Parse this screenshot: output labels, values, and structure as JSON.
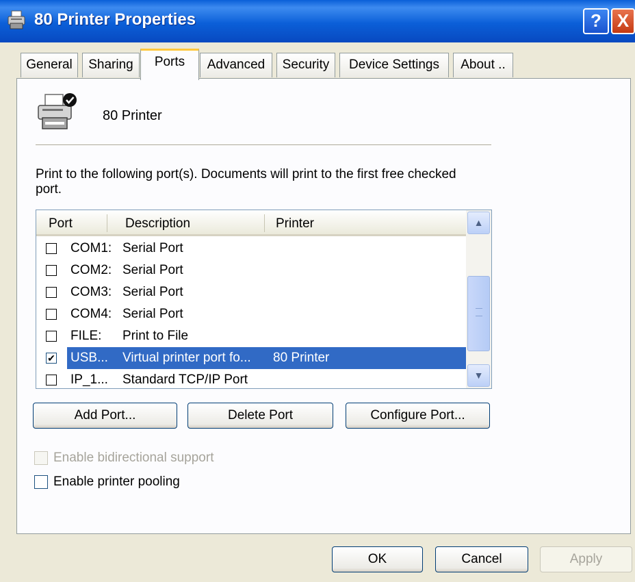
{
  "window": {
    "title": "80 Printer Properties",
    "help_icon": "?",
    "close_icon": "X"
  },
  "tabs": [
    "General",
    "Sharing",
    "Ports",
    "Advanced",
    "Security",
    "Device Settings",
    "About .."
  ],
  "active_tab": "Ports",
  "printer_name": "80 Printer",
  "description": "Print to the following port(s). Documents will print to the first free checked port.",
  "ports_list": {
    "columns": [
      "Port",
      "Description",
      "Printer"
    ],
    "rows": [
      {
        "port": "COM1:",
        "description": "Serial Port",
        "printer": "",
        "checked": false,
        "selected": false
      },
      {
        "port": "COM2:",
        "description": "Serial Port",
        "printer": "",
        "checked": false,
        "selected": false
      },
      {
        "port": "COM3:",
        "description": "Serial Port",
        "printer": "",
        "checked": false,
        "selected": false
      },
      {
        "port": "COM4:",
        "description": "Serial Port",
        "printer": "",
        "checked": false,
        "selected": false
      },
      {
        "port": "FILE:",
        "description": "Print to File",
        "printer": "",
        "checked": false,
        "selected": false
      },
      {
        "port": "USB...",
        "description": "Virtual printer port fo...",
        "printer": "80 Printer",
        "checked": true,
        "selected": true
      },
      {
        "port": "IP_1...",
        "description": "Standard TCP/IP Port",
        "printer": "",
        "checked": false,
        "selected": false
      }
    ]
  },
  "port_buttons": {
    "add": "Add Port...",
    "delete": "Delete Port",
    "configure": "Configure Port..."
  },
  "options": {
    "bidirectional": {
      "label": "Enable bidirectional support",
      "checked": false,
      "enabled": false
    },
    "pooling": {
      "label": "Enable printer pooling",
      "checked": false,
      "enabled": true
    }
  },
  "dialog_buttons": {
    "ok": "OK",
    "cancel": "Cancel",
    "apply": "Apply"
  },
  "colors": {
    "title_bar": "#0b5fd8",
    "selection": "#316ac5",
    "active_tab_accent": "#ffc83c",
    "dialog_bg": "#ece9d8"
  }
}
